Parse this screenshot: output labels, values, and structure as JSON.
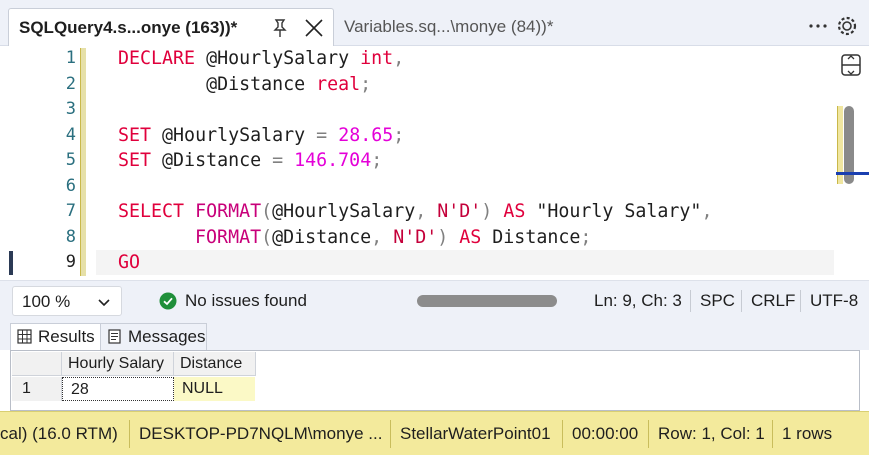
{
  "tabs": {
    "active_title": "SQLQuery4.s...onye (163))*",
    "inactive_title": "Variables.sq...\\monye (84))*"
  },
  "editor": {
    "line_numbers": [
      "1",
      "2",
      "3",
      "4",
      "5",
      "6",
      "7",
      "8",
      "9"
    ],
    "current_line": "9",
    "code": {
      "l1_declare": "DECLARE",
      "l1_var": "@HourlySalary",
      "l1_type": "int",
      "l1_comma": ",",
      "l2_var": "@Distance",
      "l2_type": "real",
      "l2_semi": ";",
      "l4_set": "SET",
      "l4_var": "@HourlySalary",
      "l4_eq": "=",
      "l4_val": "28.65",
      "l4_semi": ";",
      "l5_set": "SET",
      "l5_var": "@Distance",
      "l5_eq": "=",
      "l5_val": "146.704",
      "l5_semi": ";",
      "l7_select": "SELECT",
      "l7_format": "FORMAT",
      "l7_open": "(",
      "l7_var": "@HourlySalary",
      "l7_comma": ",",
      "l7_arg": "N'D'",
      "l7_close": ")",
      "l7_as": "AS",
      "l7_alias": "\"Hourly Salary\"",
      "l7_comma2": ",",
      "l8_format": "FORMAT",
      "l8_open": "(",
      "l8_var": "@Distance",
      "l8_comma": ",",
      "l8_arg": "N'D'",
      "l8_close": ")",
      "l8_as": "AS",
      "l8_alias": "Distance",
      "l8_semi": ";",
      "l9_go": "GO"
    }
  },
  "editor_status": {
    "zoom": "100 %",
    "issues": "No issues found",
    "position": "Ln: 9, Ch: 3",
    "whitespace": "SPC",
    "line_ending": "CRLF",
    "encoding": "UTF-8"
  },
  "result_tabs": {
    "results": "Results",
    "messages": "Messages"
  },
  "grid": {
    "columns": [
      "Hourly Salary",
      "Distance"
    ],
    "rows": [
      {
        "rownum": "1",
        "values": [
          "28",
          "NULL"
        ]
      }
    ]
  },
  "statusbar": {
    "version": "cal) (16.0 RTM)",
    "user": "DESKTOP-PD7NQLM\\monye ...",
    "database": "StellarWaterPoint01",
    "elapsed": "00:00:00",
    "rowcol": "Row: 1, Col: 1",
    "rows": "1 rows"
  },
  "colors": {
    "keyword": "#e0003c",
    "number": "#e400d8",
    "statusbar_bg": "#f3ea9c",
    "null_cell_bg": "#fbf9c6",
    "success_icon": "#1f8f3a"
  },
  "icons": {
    "pin": "pin-icon",
    "close": "close-icon",
    "more": "more-icon",
    "settings": "gear-icon",
    "split": "split-editor-icon",
    "issues": "check-circle-icon",
    "results": "grid-icon",
    "messages": "messages-icon"
  }
}
